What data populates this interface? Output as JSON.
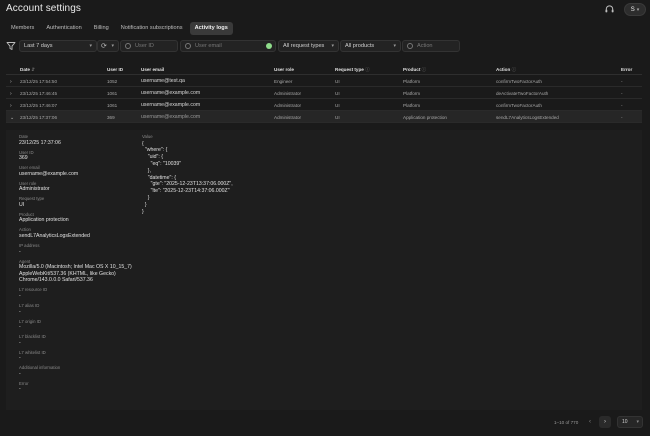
{
  "app": {
    "title": "Account settings",
    "avatar_initial": "S"
  },
  "tabs": [
    {
      "label": "Members"
    },
    {
      "label": "Authentication"
    },
    {
      "label": "Billing"
    },
    {
      "label": "Notification subscriptions"
    },
    {
      "label": "Activity logs",
      "active": true
    }
  ],
  "filters": {
    "date_range": "Last 7 days",
    "user_id_placeholder": "User ID",
    "user_email_placeholder": "User email",
    "request_type": "All request types",
    "product": "All products",
    "action_placeholder": "Action"
  },
  "table": {
    "headers": {
      "date": "Date",
      "user_id": "User ID",
      "user_email": "User email",
      "user_role": "User role",
      "request_type": "Request type",
      "product": "Product",
      "action": "Action",
      "error": "Error"
    },
    "rows": [
      {
        "date": "23/12/25 17:54:50",
        "user_id": "1052",
        "user_email": "username@test.qa",
        "user_role": "Engineer",
        "request_type": "UI",
        "product": "Platform",
        "action": "confirmTwoFactorAuth",
        "error": "-"
      },
      {
        "date": "23/12/25 17:46:45",
        "user_id": "1061",
        "user_email": "username@example.com",
        "user_role": "Administrator",
        "request_type": "UI",
        "product": "Platform",
        "action": "deActivateTwoFactorAuth",
        "error": "-"
      },
      {
        "date": "23/12/25 17:46:07",
        "user_id": "1061",
        "user_email": "username@example.com",
        "user_role": "Administrator",
        "request_type": "UI",
        "product": "Platform",
        "action": "confirmTwoFactorAuth",
        "error": "-"
      },
      {
        "date": "23/12/25 17:37:06",
        "user_id": "369",
        "user_email": "username@example.com",
        "user_role": "Administrator",
        "request_type": "UI",
        "product": "Application protection",
        "action": "sendL7AnalyticsLogsExtended",
        "error": "-"
      }
    ]
  },
  "expanded": {
    "details": [
      {
        "label": "Date",
        "value": "23/12/25 17:37:06"
      },
      {
        "label": "User ID",
        "value": "369"
      },
      {
        "label": "User email",
        "value": "username@example.com"
      },
      {
        "label": "User role",
        "value": "Administrator"
      },
      {
        "label": "Request type",
        "value": "UI"
      },
      {
        "label": "Product",
        "value": "Application protection"
      },
      {
        "label": "Action",
        "value": "sendL7AnalyticsLogsExtended"
      },
      {
        "label": "IP address",
        "value": "-"
      },
      {
        "label": "Agent",
        "value": "Mozilla/5.0 (Macintosh; Intel Mac OS X 10_15_7) AppleWebKit/537.36 (KHTML, like Gecko) Chrome/143.0.0.0 Safari/537.36"
      },
      {
        "label": "L7 resource ID",
        "value": "-"
      },
      {
        "label": "L7 alias ID",
        "value": "-"
      },
      {
        "label": "L7 origin ID",
        "value": "-"
      },
      {
        "label": "L7 blacklist ID",
        "value": "-"
      },
      {
        "label": "L7 whitelist ID",
        "value": "-"
      },
      {
        "label": "Additional information",
        "value": "-"
      },
      {
        "label": "Error",
        "value": "-"
      }
    ],
    "value_label": "Value",
    "json_lines": [
      "{",
      "  \"where\": {",
      "    \"uid\": {",
      "      \"eq\": \"10039\"",
      "    },",
      "    \"datetime\": {",
      "      \"gte\": \"2025-12-23T13:37:06.000Z\",",
      "      \"lte\": \"2025-12-23T14:37:06.000Z\"",
      "    }",
      "  }",
      "}"
    ]
  },
  "pagination": {
    "summary": "1–10 of 770",
    "page_size": "10"
  }
}
